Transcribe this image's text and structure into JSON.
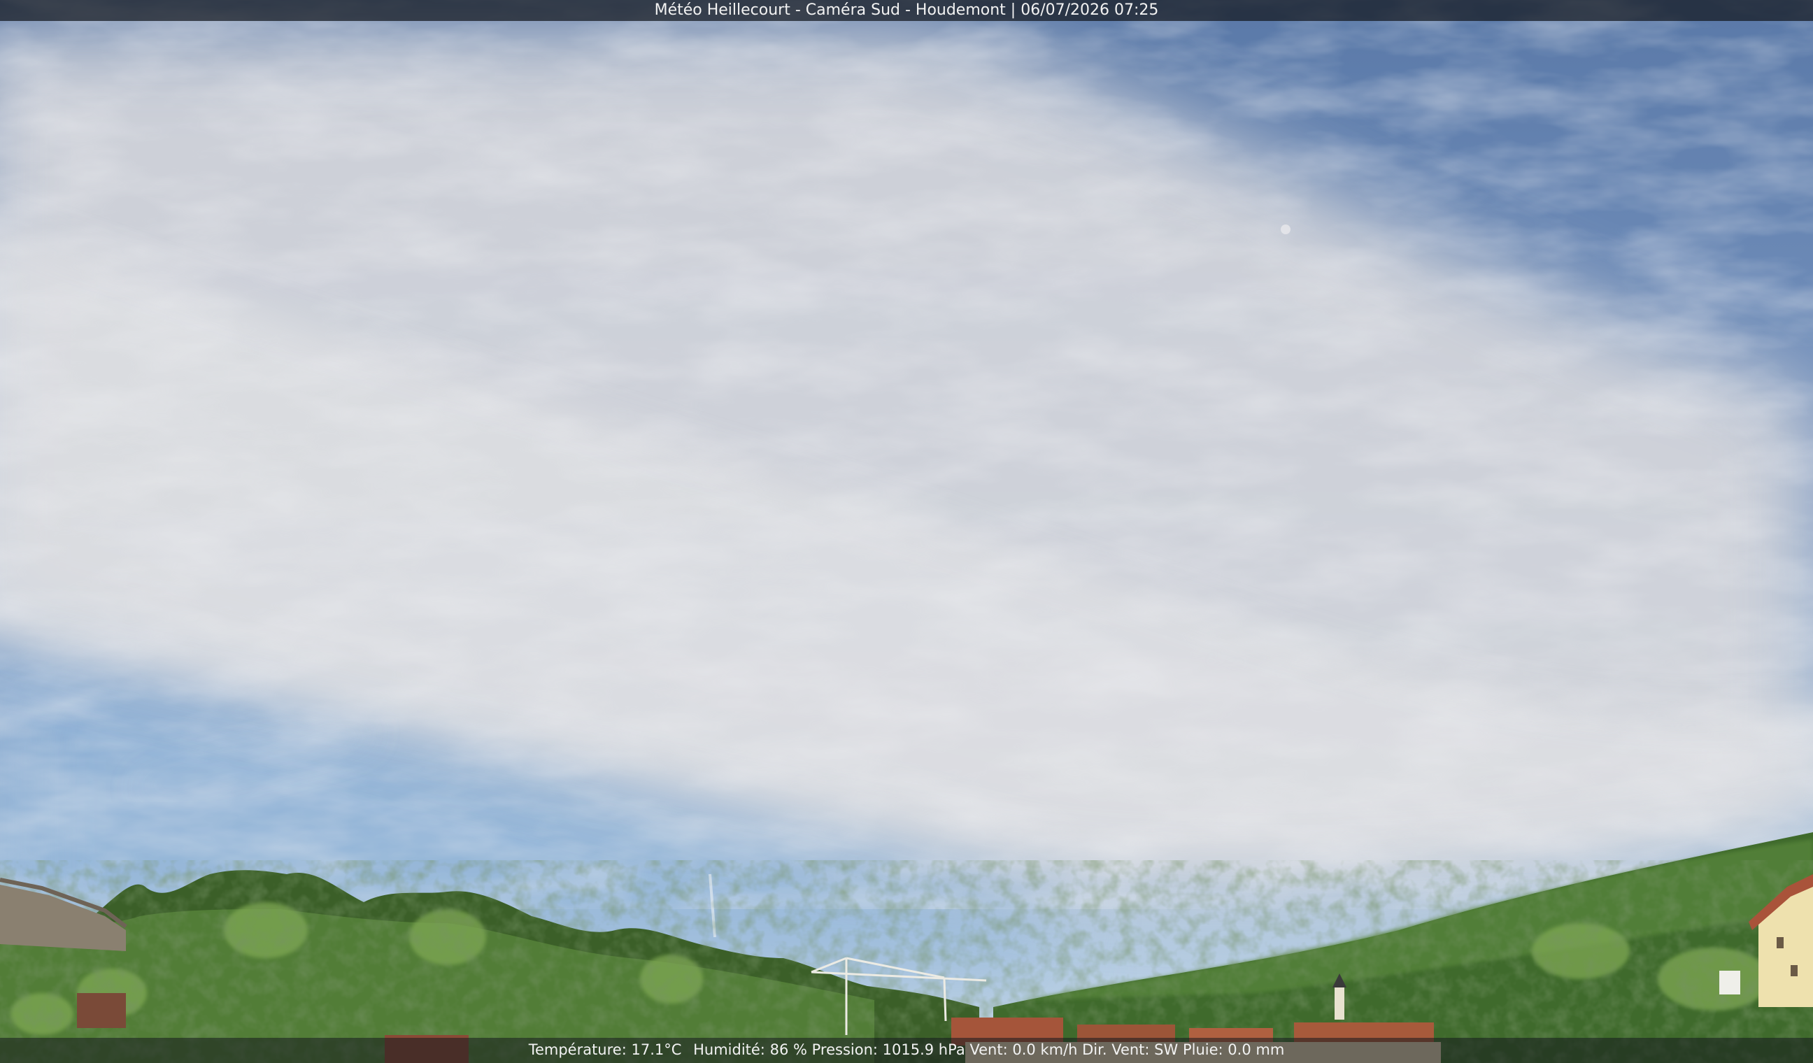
{
  "overlay": {
    "title": "Météo Heillecourt - Caméra Sud - Houdemont | 06/07/2026 07:25"
  },
  "weather": {
    "temperature_label": "Température:",
    "temperature_value": "17.1°C",
    "humidity_label": "Humidité:",
    "humidity_value": "86 %",
    "pressure_label": "Pression:",
    "pressure_value": "1015.9 hPa",
    "wind_label": "Vent:",
    "wind_value": "0.0 km/h",
    "wind_dir_label": "Dir. Vent:",
    "wind_dir_value": "SW",
    "rain_label": "Pluie:",
    "rain_value": "0.0 mm"
  },
  "colors": {
    "sky_top": "#5e7fae",
    "sky_horizon": "#b9d0e6",
    "cloud": "#d7d9de",
    "tree_dark": "#2f4a22",
    "tree_mid": "#4f7a33",
    "tree_light": "#8fb35a",
    "roof": "#a5553a",
    "house": "#efe3b0"
  }
}
